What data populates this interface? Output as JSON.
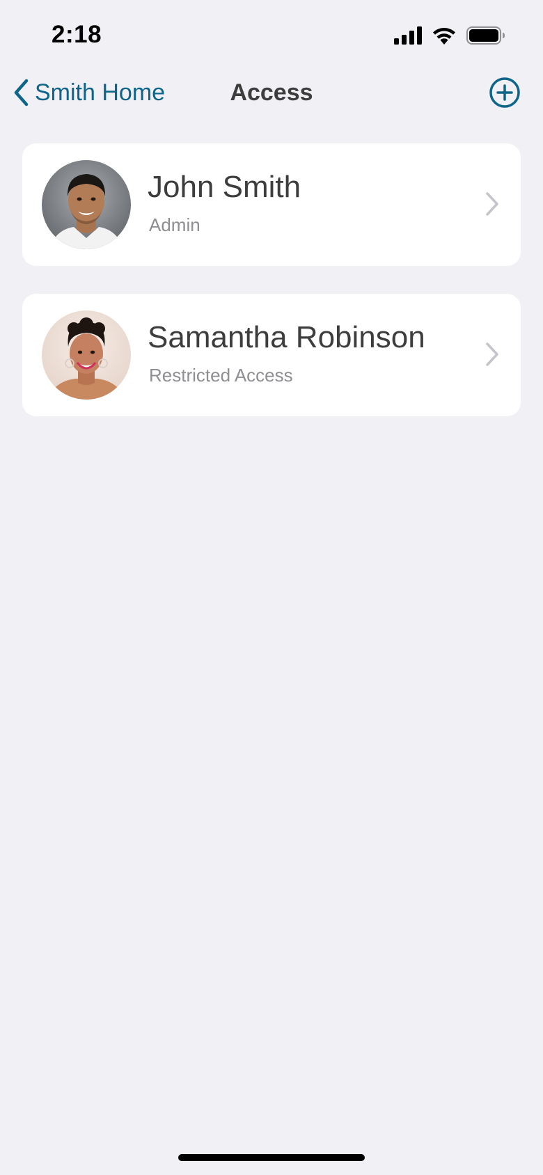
{
  "status_bar": {
    "time": "2:18"
  },
  "nav": {
    "back_label": "Smith Home",
    "title": "Access",
    "add_icon": "plus-circle-icon",
    "accent_color": "#0e6589"
  },
  "users": [
    {
      "name": "John Smith",
      "role": "Admin"
    },
    {
      "name": "Samantha Robinson",
      "role": "Restricted Access"
    }
  ],
  "colors": {
    "background": "#f0f0f5",
    "card": "#ffffff",
    "primary_text": "#3d3d3d",
    "secondary_text": "#8e8e93",
    "accent": "#0e6589"
  }
}
